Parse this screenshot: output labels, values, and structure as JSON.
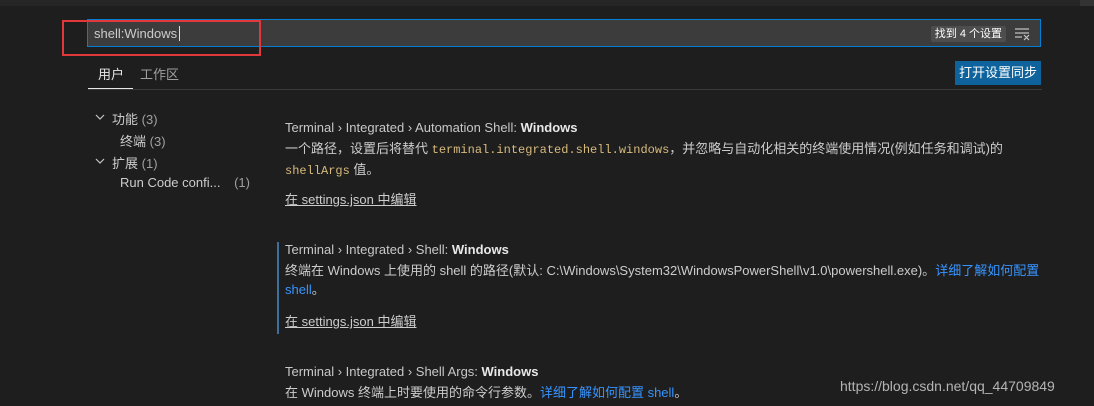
{
  "search": {
    "value": "shell:Windows",
    "found_label": "找到 4 个设置"
  },
  "tabs": [
    {
      "label": "用户"
    },
    {
      "label": "工作区"
    }
  ],
  "sync_button_label": "打开设置同步",
  "toc": [
    {
      "label": "功能",
      "count": "(3)"
    },
    {
      "label": "终端",
      "count": "(3)"
    },
    {
      "label": "扩展",
      "count": "(1)"
    },
    {
      "label": "Run Code confi...",
      "count": "(1)"
    }
  ],
  "settings": [
    {
      "title_prefix": "Terminal › Integrated › Automation Shell: ",
      "title_name": "Windows",
      "desc_1": "一个路径，设置后将替代 ",
      "code_1": "terminal.integrated.shell.windows",
      "desc_2": "，并忽略与自动化相关的终端使用情况(例如任务和调试)的",
      "code_2": "shellArgs",
      "desc_3": " 值。",
      "edit_link": "在 settings.json 中编辑"
    },
    {
      "title_prefix": "Terminal › Integrated › Shell: ",
      "title_name": "Windows",
      "desc_1": "终端在 Windows 上使用的 shell 的路径(默认: C:\\Windows\\System32\\WindowsPowerShell\\v1.0\\powershell.exe)。",
      "link": "详细了解如何配置 shell",
      "desc_2": "。",
      "edit_link": "在 settings.json 中编辑"
    },
    {
      "title_prefix": "Terminal › Integrated › Shell Args: ",
      "title_name": "Windows",
      "desc_1": "在 Windows 终端上时要使用的命令行参数。",
      "link": "详细了解如何配置 shell",
      "desc_2": "。"
    }
  ],
  "watermark": "https://blog.csdn.net/qq_44709849",
  "colors": {
    "accent": "#007fd4",
    "button": "#0e639c",
    "link": "#3794ff",
    "code": "#d7ba7d",
    "highlight": "#e0383b"
  },
  "icons": [
    "filter-icon",
    "chevron-down-icon"
  ]
}
